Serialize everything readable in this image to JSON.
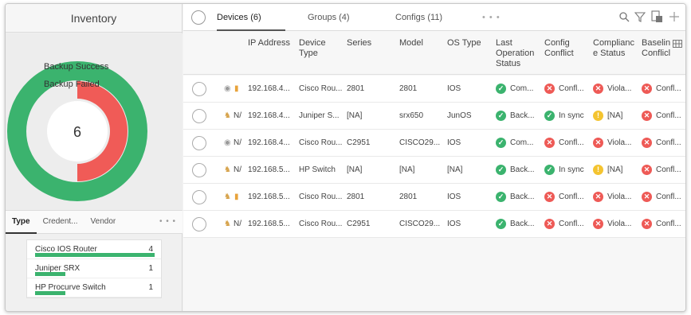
{
  "left": {
    "title": "Inventory",
    "legend": [
      "Backup Success",
      "Backup Failed"
    ],
    "center_value": "6",
    "donut": {
      "success": 1.0,
      "failed": 0.5,
      "success_color": "#3bb36e",
      "failed_color": "#f05b57"
    },
    "subtabs": [
      "Type",
      "Credent...",
      "Vendor",
      "• • •"
    ],
    "types": [
      {
        "label": "Cisco IOS Router",
        "count": "4",
        "fraction": 1.0
      },
      {
        "label": "Juniper SRX",
        "count": "1",
        "fraction": 0.25
      },
      {
        "label": "HP Procurve Switch",
        "count": "1",
        "fraction": 0.25
      }
    ]
  },
  "tabs": {
    "devices": "Devices",
    "devices_count": "(6)",
    "groups": "Groups (4)",
    "configs": "Configs (11)",
    "more": "• • •"
  },
  "columns": {
    "ip": "IP Address",
    "dtype1": "Device",
    "dtype2": "Type",
    "series": "Series",
    "model": "Model",
    "os": "OS Type",
    "last1": "Last",
    "last2": "Operation",
    "last3": "Status",
    "conf1": "Config",
    "conf2": "Conflict",
    "comp1": "Complianc",
    "comp2": "e Status",
    "base1": "Baselin",
    "base2": "Conflicl"
  },
  "rows": [
    {
      "na": "",
      "ip": "192.168.4...",
      "dtype": "Cisco Rou...",
      "series": "2801",
      "model": "2801",
      "os": "IOS",
      "last": "Com...",
      "conf": "Confl...",
      "comp": "Viola...",
      "base": "Confl...",
      "conf_state": "bad",
      "comp_state": "bad"
    },
    {
      "na": "N/",
      "ip": "192.168.4...",
      "dtype": "Juniper S...",
      "series": "[NA]",
      "model": "srx650",
      "os": "JunOS",
      "last": "Back...",
      "conf": "In sync",
      "comp": "[NA]",
      "base": "Confl...",
      "conf_state": "ok",
      "comp_state": "warn"
    },
    {
      "na": "N/",
      "ip": "192.168.4...",
      "dtype": "Cisco Rou...",
      "series": "C2951",
      "model": "CISCO29...",
      "os": "IOS",
      "last": "Com...",
      "conf": "Confl...",
      "comp": "Viola...",
      "base": "Confl...",
      "conf_state": "bad",
      "comp_state": "bad"
    },
    {
      "na": "N/",
      "ip": "192.168.5...",
      "dtype": "HP Switch",
      "series": "[NA]",
      "model": "[NA]",
      "os": "[NA]",
      "last": "Back...",
      "conf": "In sync",
      "comp": "[NA]",
      "base": "Confl...",
      "conf_state": "ok",
      "comp_state": "warn"
    },
    {
      "na": "",
      "ip": "192.168.5...",
      "dtype": "Cisco Rou...",
      "series": "2801",
      "model": "2801",
      "os": "IOS",
      "last": "Back...",
      "conf": "Confl...",
      "comp": "Viola...",
      "base": "Confl...",
      "conf_state": "bad",
      "comp_state": "bad"
    },
    {
      "na": "N/",
      "ip": "192.168.5...",
      "dtype": "Cisco Rou...",
      "series": "C2951",
      "model": "CISCO29...",
      "os": "IOS",
      "last": "Back...",
      "conf": "Confl...",
      "comp": "Viola...",
      "base": "Confl...",
      "conf_state": "bad",
      "comp_state": "bad"
    }
  ]
}
